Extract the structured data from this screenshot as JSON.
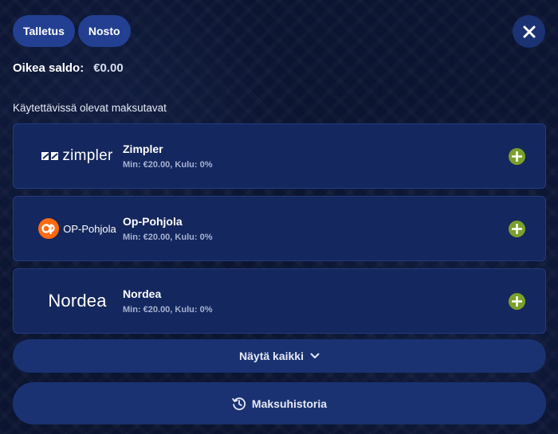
{
  "tabs": [
    {
      "label": "Talletus"
    },
    {
      "label": "Nosto"
    }
  ],
  "balance": {
    "label": "Oikea saldo:",
    "value": "€0.00"
  },
  "section_title": "Käytettävissä olevat maksutavat",
  "methods": [
    {
      "name": "Zimpler",
      "meta": "Min: €20.00, Kulu: 0%",
      "logo_text": "zimpler"
    },
    {
      "name": "Op-Pohjola",
      "meta": "Min: €20.00, Kulu: 0%",
      "logo_text": "OP-Pohjola"
    },
    {
      "name": "Nordea",
      "meta": "Min: €20.00, Kulu: 0%",
      "logo_text": "Nordea"
    }
  ],
  "show_all_label": "Näytä kaikki",
  "history_label": "Maksuhistoria",
  "colors": {
    "accent_add": "#7aa02a",
    "op_orange": "#ff6a10",
    "tab_bg": "#223f91",
    "card_bg": "#14275e"
  }
}
